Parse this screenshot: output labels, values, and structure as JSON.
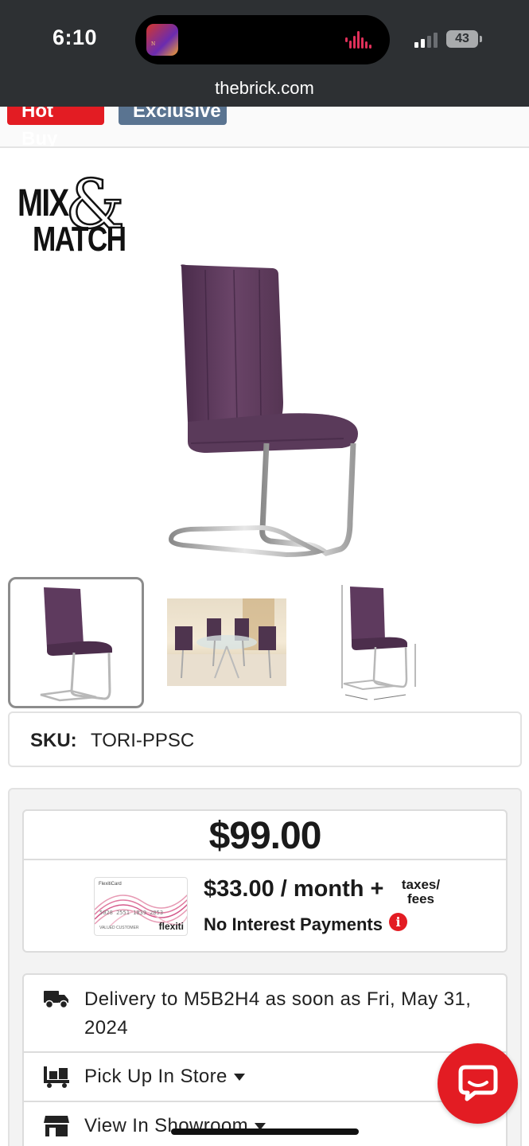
{
  "status_bar": {
    "time": "6:10",
    "battery": "43",
    "url": "thebrick.com",
    "icons": [
      "app-icon",
      "audio-wave-icon",
      "signal-icon",
      "battery-icon"
    ]
  },
  "badges": {
    "hot": "Hot Buy",
    "exclusive": "Exclusive"
  },
  "logo": {
    "mix": "MIX",
    "amp": "&",
    "match": "MATCH"
  },
  "product": {
    "sku_label": "SKU:",
    "sku_value": "TORI-PPSC",
    "thumbnails": [
      "chair-front",
      "dining-set",
      "chair-dimensions"
    ]
  },
  "pricing": {
    "price": "$99.00",
    "monthly": "$33.00 / month +",
    "taxes_line1": "taxes/",
    "taxes_line2": "fees",
    "no_interest": "No Interest Payments",
    "card": {
      "label": "FlexitiCard",
      "number": "5028 2551 1839 2853",
      "holder": "VALUED CUSTOMER",
      "brand": "flexiti"
    }
  },
  "fulfillment": {
    "delivery": "Delivery to M5B2H4 as soon as Fri, May 31, 2024",
    "pickup": "Pick Up In Store",
    "showroom": "View In Showroom"
  },
  "colors": {
    "brand_red": "#e31c23",
    "exclusive_blue": "#5a7491",
    "chair_purple": "#5e3a5e",
    "status_bar": "#2d3033"
  }
}
